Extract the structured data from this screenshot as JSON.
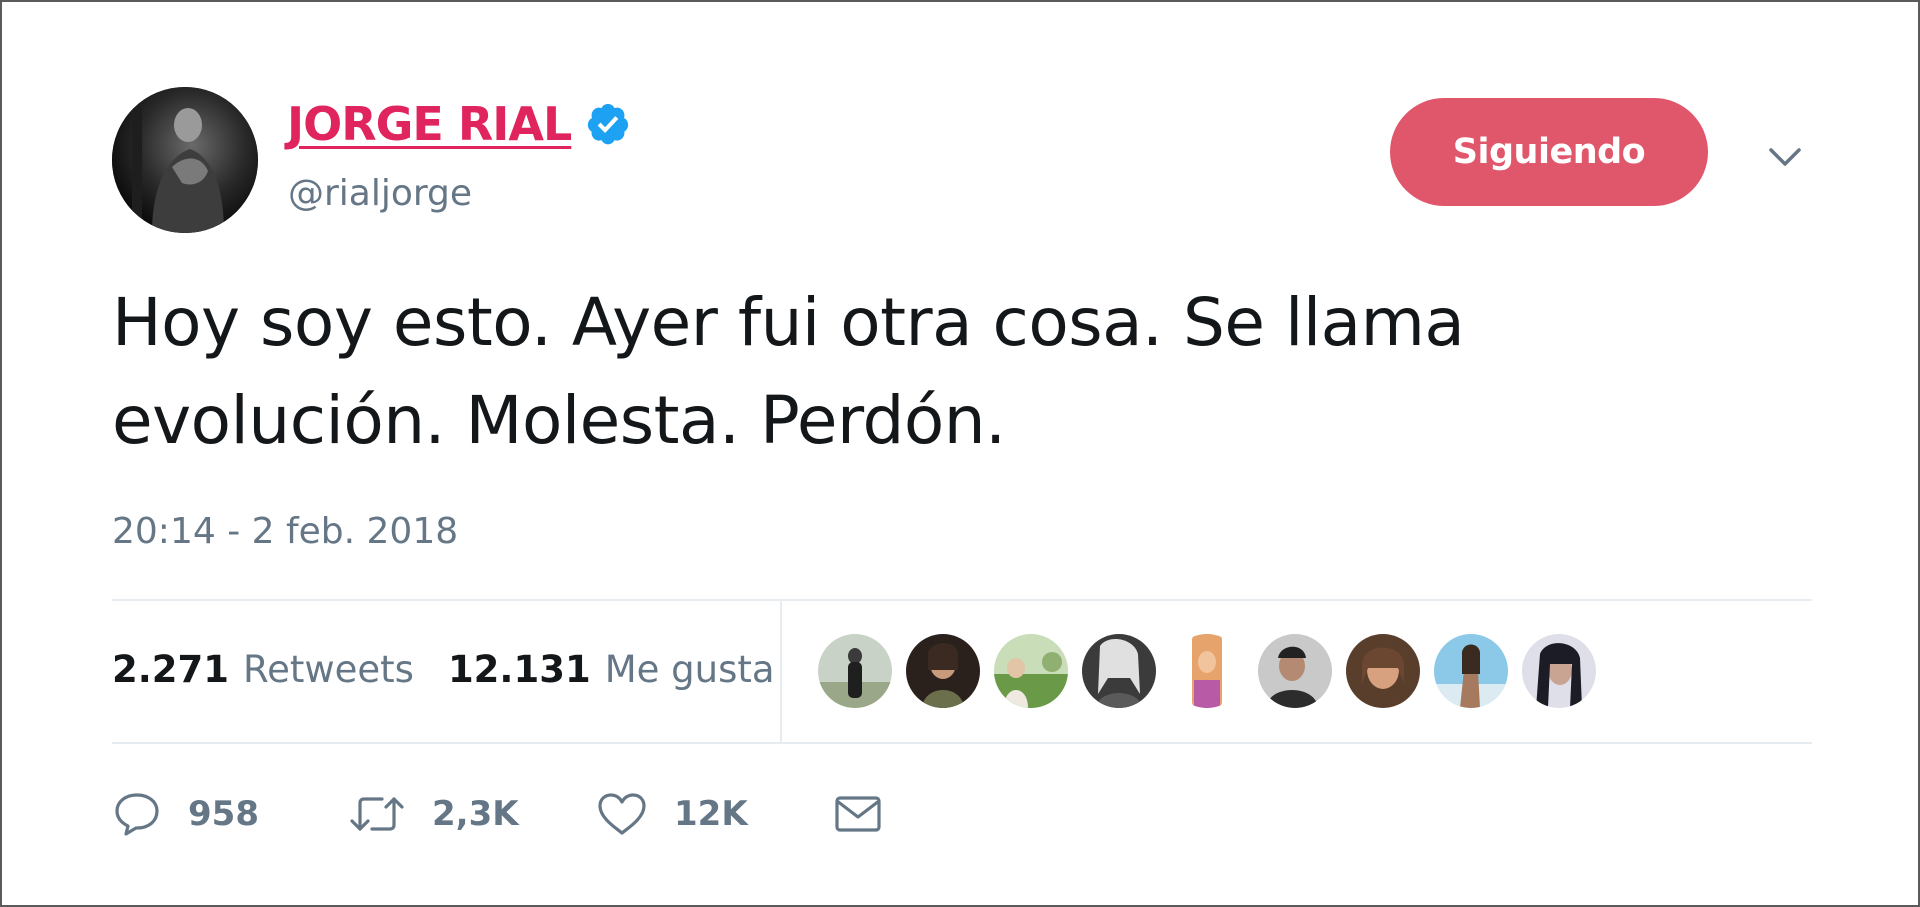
{
  "user": {
    "display_name": "JORGE RIAL",
    "handle": "@rialjorge",
    "verified": true,
    "name_color": "#e0245e"
  },
  "follow_button": {
    "label": "Siguiendo",
    "color": "#e0576b"
  },
  "tweet": {
    "text_line1": "Hoy soy esto. Ayer fui otra cosa. Se llama",
    "text_line2": "evolución. Molesta. Perdón.",
    "timestamp": "20:14 - 2 feb. 2018"
  },
  "stats": {
    "retweets_count": "2.271",
    "retweets_label": "Retweets",
    "likes_count": "12.131",
    "likes_label": "Me gusta"
  },
  "likers": [
    {
      "icon": "avatar-1"
    },
    {
      "icon": "avatar-2"
    },
    {
      "icon": "avatar-3"
    },
    {
      "icon": "avatar-4"
    },
    {
      "icon": "avatar-5"
    },
    {
      "icon": "avatar-6"
    },
    {
      "icon": "avatar-7"
    },
    {
      "icon": "avatar-8"
    },
    {
      "icon": "avatar-9"
    }
  ],
  "actions": {
    "replies": "958",
    "retweets": "2,3K",
    "likes": "12K"
  },
  "icons": {
    "verified": "verified-badge-icon",
    "caret": "chevron-down-icon",
    "reply": "reply-icon",
    "retweet": "retweet-icon",
    "like": "heart-icon",
    "message": "envelope-icon"
  }
}
